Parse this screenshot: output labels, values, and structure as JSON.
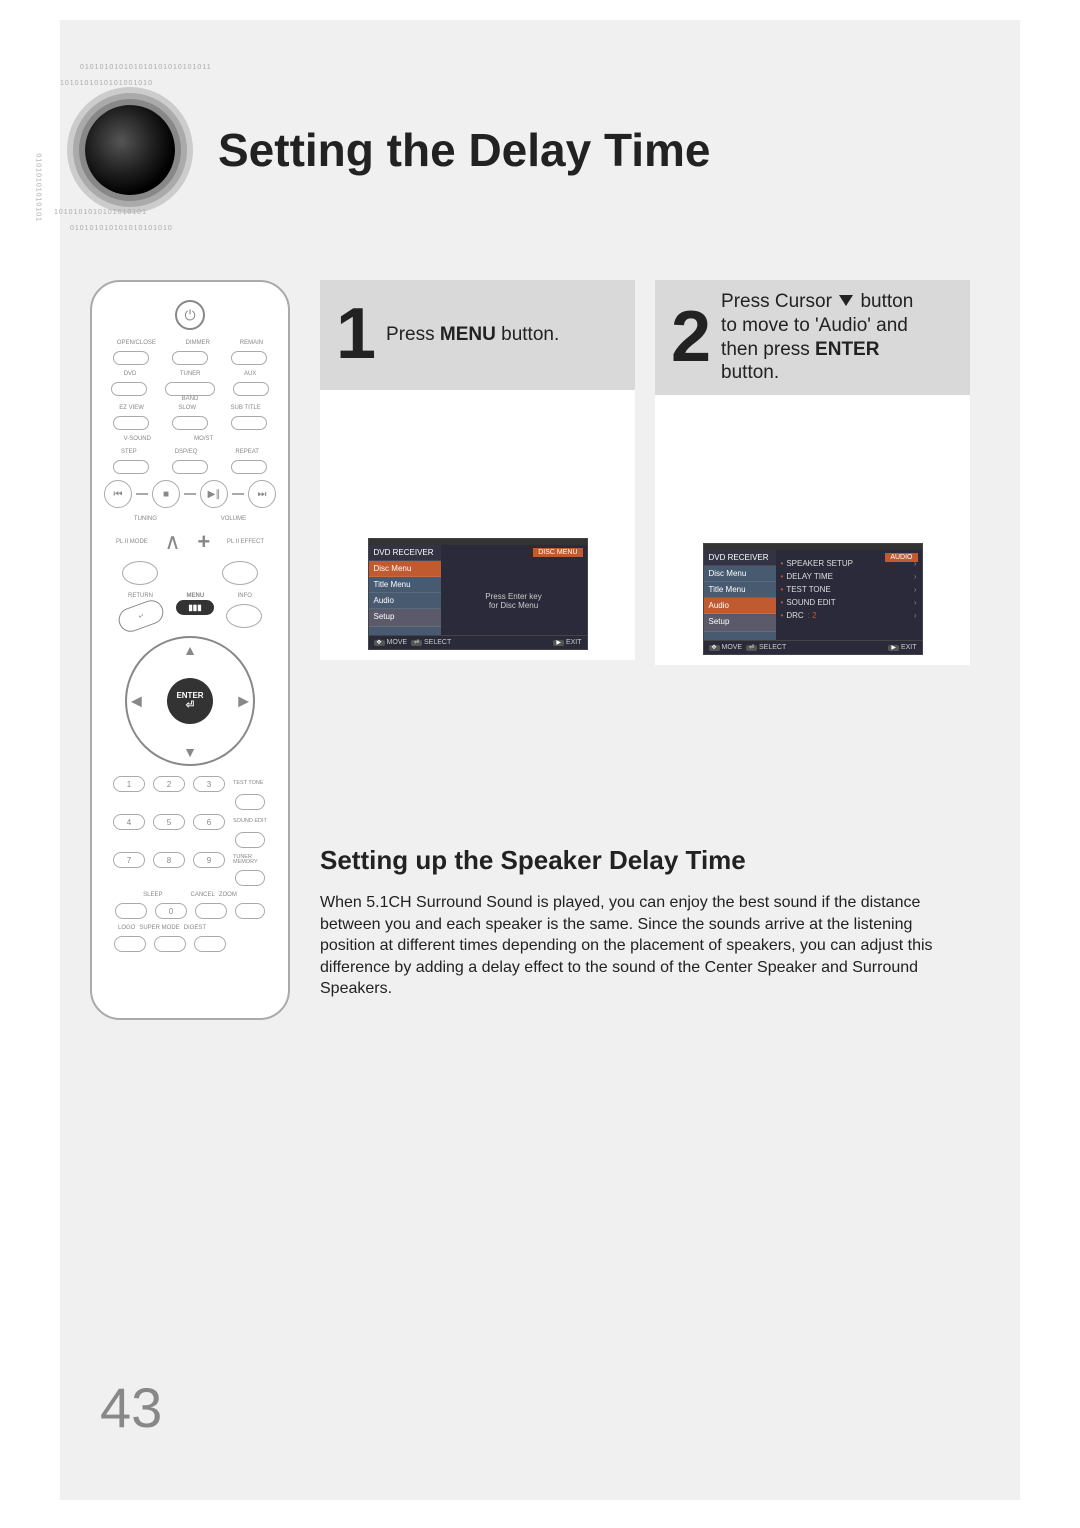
{
  "title": "Setting the Delay Time",
  "page_number": "43",
  "step1": {
    "number": "1",
    "text_pre": "Press ",
    "text_bold": "MENU",
    "text_post": " button."
  },
  "step2": {
    "number": "2",
    "line1_pre": "Press Cursor ",
    "line1_post": " button",
    "line2": "to move to 'Audio' and",
    "line3_pre": "then press ",
    "line3_bold": "ENTER",
    "line4": "button."
  },
  "osd1": {
    "side": {
      "player": "DVD RECEIVER",
      "disc_menu": "Disc Menu",
      "title_menu": "Title Menu",
      "audio": "Audio",
      "setup": "Setup"
    },
    "header": "DISC MENU",
    "body_line1": "Press Enter key",
    "body_line2": "for Disc Menu",
    "foot": {
      "move": "MOVE",
      "select": "SELECT",
      "exit": "EXIT"
    }
  },
  "osd2": {
    "side": {
      "player": "DVD RECEIVER",
      "disc_menu": "Disc Menu",
      "title_menu": "Title Menu",
      "audio": "Audio",
      "setup": "Setup"
    },
    "header": "AUDIO",
    "items": {
      "speaker_setup": "SPEAKER SETUP",
      "delay_time": "DELAY TIME",
      "test_tone": "TEST TONE",
      "sound_edit": "SOUND EDIT",
      "drc": "DRC",
      "drc_value": ": 2"
    },
    "foot": {
      "move": "MOVE",
      "select": "SELECT",
      "exit": "EXIT"
    }
  },
  "remote": {
    "open_close": "OPEN/CLOSE",
    "dimmer": "DIMMER",
    "remain": "REMAIN",
    "dvd": "DVD",
    "tuner": "TUNER",
    "aux": "AUX",
    "band": "BAND",
    "ezview": "EZ VIEW",
    "slow": "SLOW",
    "subtitle": "SUB TITLE",
    "vsound": "V-SOUND",
    "mo_st": "MO/ST",
    "step": "STEP",
    "dsp_eq": "DSP/EQ",
    "repeat": "REPEAT",
    "tuning": "TUNING",
    "volume": "VOLUME",
    "pl_mode": "PL II MODE",
    "pl_effect": "PL II EFFECT",
    "menu": "MENU",
    "info": "INFO",
    "return": "RETURN",
    "enter": "ENTER",
    "test_tone": "TEST TONE",
    "sound_edit": "SOUND EDIT",
    "tuner_memory": "TUNER MEMORY",
    "sleep": "SLEEP",
    "cancel": "CANCEL",
    "zoom": "ZOOM",
    "logo": "LOGO",
    "sdsf_mode": "SUPER MODE",
    "digest": "DIGEST",
    "nums": [
      "1",
      "2",
      "3",
      "4",
      "5",
      "6",
      "7",
      "8",
      "9",
      "0"
    ]
  },
  "lower": {
    "heading": "Setting up the Speaker Delay Time",
    "paragraph": "When 5.1CH Surround Sound is played, you can enjoy the best sound if the distance between you and each speaker is the same. Since the sounds arrive at the listening position at different times depending on the placement of speakers, you can adjust this difference by adding a delay effect to the sound of the Center Speaker and Surround Speakers."
  }
}
